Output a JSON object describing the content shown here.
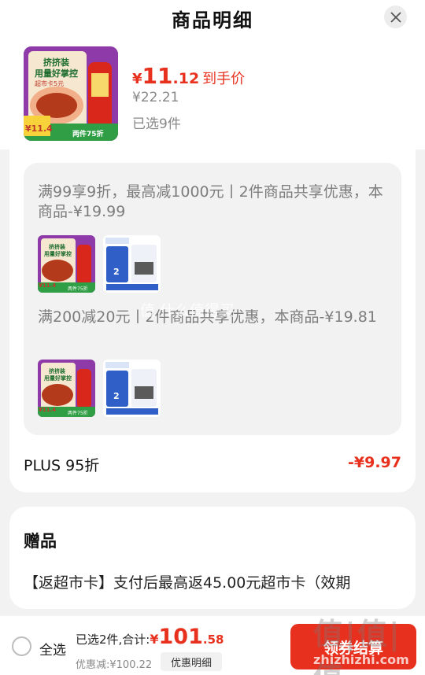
{
  "header": {
    "title": "商品明细"
  },
  "product": {
    "price_currency": "¥",
    "price_int": "11",
    "price_dec": ".12",
    "price_tag": "到手价",
    "original_price": "¥22.21",
    "selected_count": "已选9件",
    "thumb_text": {
      "line1": "挤挤装",
      "line2": "用量好掌控",
      "badge": "超市卡5元",
      "price": "¥11.4",
      "discount": "两件75折"
    }
  },
  "promotions": [
    {
      "text": "满99享9折，最高减1000元丨2件商品共享优惠，本商品-¥19.99",
      "thumbs": [
        {
          "lines": [
            "挤挤装",
            "用量好掌控"
          ],
          "price": "¥11.4",
          "discount": "两件75折"
        },
        {
          "lines": [
            "2"
          ],
          "price": "",
          "discount": ""
        }
      ]
    },
    {
      "text": "满200减20元丨2件商品共享优惠，本商品-¥19.81",
      "thumbs": [
        {
          "lines": [
            "挤挤装",
            "用量好掌控"
          ],
          "price": "¥11.4",
          "discount": "两件75折"
        },
        {
          "lines": [
            "2"
          ],
          "price": "",
          "discount": ""
        }
      ]
    }
  ],
  "plus": {
    "label": "PLUS 95折",
    "amount": "-¥9.97"
  },
  "gift": {
    "title": "赠品",
    "desc": "【返超市卡】支付后最高返45.00元超市卡（效期"
  },
  "footer": {
    "select_all": "全选",
    "total_label": "已选2件,合计:",
    "total_currency": "¥",
    "total_int": "101",
    "total_dec": ".58",
    "discount_text": "优惠减:¥100.22",
    "detail_button": "优惠明细",
    "checkout_button": "领券结算"
  },
  "watermarks": {
    "site": "值|值|值",
    "url": "zhizhizhi.com",
    "mid": "值 什么值得买"
  },
  "colors": {
    "accent": "#e8301e",
    "thumb_purple": "#8e3aa8",
    "thumb_green": "#34a853"
  }
}
